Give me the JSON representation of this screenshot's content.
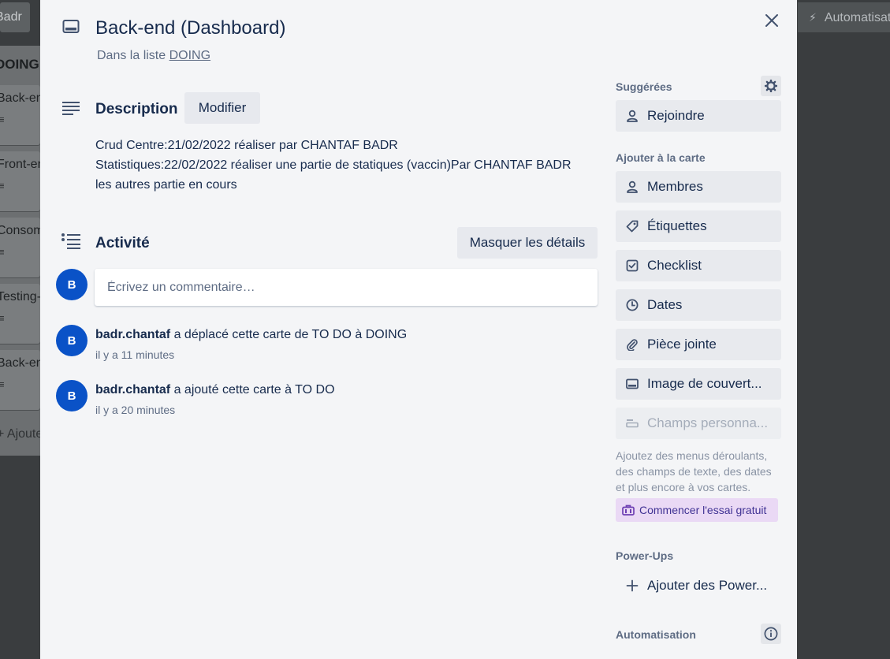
{
  "background": {
    "top_button_label": "Badr",
    "automation_label": "Automatisation",
    "list_title": "DOING",
    "cards": [
      "Back-end",
      "Front-end",
      "Consommation",
      "Testing-m",
      "Back-end"
    ],
    "add_card_label": "+ Ajouter une carte"
  },
  "card": {
    "title": "Back-end (Dashboard)",
    "in_list_prefix": "Dans la liste",
    "list_name": "DOING"
  },
  "description": {
    "heading": "Description",
    "edit_label": "Modifier",
    "lines": [
      "Crud Centre:21/02/2022 réaliser par CHANTAF BADR",
      "Statistiques:22/02/2022 réaliser une partie de statiques (vaccin)Par CHANTAF BADR",
      "les autres partie en cours"
    ]
  },
  "activity": {
    "heading": "Activité",
    "toggle_details_label": "Masquer les détails",
    "comment_placeholder": "Écrivez un commentaire…",
    "avatar_initial": "B",
    "items": [
      {
        "user": "badr.chantaf",
        "action": " a déplacé cette carte de TO DO à DOING",
        "time": "il y a 11 minutes"
      },
      {
        "user": "badr.chantaf",
        "action": " a ajouté cette carte à TO DO",
        "time": "il y a 20 minutes"
      }
    ]
  },
  "sidebar": {
    "suggested_heading": "Suggérées",
    "join_label": "Rejoindre",
    "add_to_card_heading": "Ajouter à la carte",
    "add_items": [
      {
        "label": "Membres",
        "icon": "person-icon"
      },
      {
        "label": "Étiquettes",
        "icon": "tag-icon"
      },
      {
        "label": "Checklist",
        "icon": "checkbox-icon"
      },
      {
        "label": "Dates",
        "icon": "clock-icon"
      },
      {
        "label": "Pièce jointe",
        "icon": "paperclip-icon"
      },
      {
        "label": "Image de couvert...",
        "icon": "cover-image-icon"
      }
    ],
    "custom_fields_label": "Champs personna...",
    "custom_fields_note": "Ajoutez des menus déroulants, des champs de texte, des dates et plus encore à vos cartes.",
    "trial_label": "Commencer l'essai gratuit",
    "powerups_heading": "Power-Ups",
    "add_powerups_label": "Ajouter des Power...",
    "automation_heading": "Automatisation"
  },
  "colors": {
    "modal_bg": "#f4f5f7",
    "avatar_blue": "#0a52c7",
    "button_grey": "#e8eaee",
    "trial_purple": "#ead9f5",
    "text_dark": "#172b4d",
    "text_muted": "#5e6c84"
  }
}
